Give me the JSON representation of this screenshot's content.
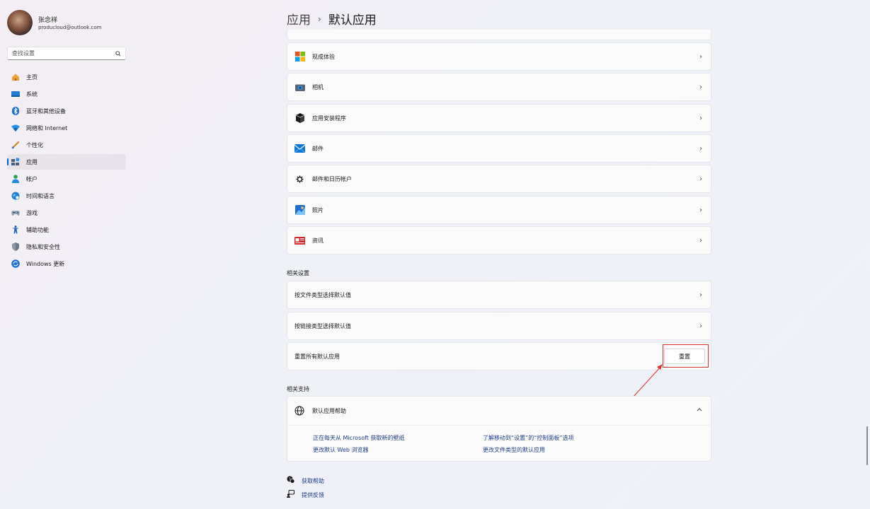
{
  "profile": {
    "name": "张念祥",
    "email": "producloud@outlook.com"
  },
  "search": {
    "placeholder": "查找设置"
  },
  "nav": [
    {
      "label": "主页",
      "icon": "home-icon"
    },
    {
      "label": "系统",
      "icon": "system-icon"
    },
    {
      "label": "蓝牙和其他设备",
      "icon": "bluetooth-icon"
    },
    {
      "label": "网络和 Internet",
      "icon": "wifi-icon"
    },
    {
      "label": "个性化",
      "icon": "brush-icon"
    },
    {
      "label": "应用",
      "icon": "apps-icon",
      "active": true
    },
    {
      "label": "帐户",
      "icon": "account-icon"
    },
    {
      "label": "时间和语言",
      "icon": "globe-clock-icon"
    },
    {
      "label": "游戏",
      "icon": "gamepad-icon"
    },
    {
      "label": "辅助功能",
      "icon": "accessibility-icon"
    },
    {
      "label": "隐私和安全性",
      "icon": "shield-icon"
    },
    {
      "label": "Windows 更新",
      "icon": "update-icon"
    }
  ],
  "breadcrumb": {
    "parent": "应用",
    "separator": "›",
    "current": "默认应用"
  },
  "apps": [
    {
      "label": "现成体验",
      "icon": "windows-logo-icon"
    },
    {
      "label": "相机",
      "icon": "camera-icon"
    },
    {
      "label": "应用安装程序",
      "icon": "box-icon"
    },
    {
      "label": "邮件",
      "icon": "mail-icon"
    },
    {
      "label": "邮件和日历帐户",
      "icon": "gear-icon"
    },
    {
      "label": "照片",
      "icon": "photos-icon"
    },
    {
      "label": "资讯",
      "icon": "news-icon"
    }
  ],
  "related_settings": {
    "heading": "相关设置",
    "by_file_type": "按文件类型选择默认值",
    "by_link_type": "按链接类型选择默认值",
    "reset_label": "重置所有默认应用",
    "reset_button": "重置"
  },
  "related_support": {
    "heading": "相关支持",
    "help_title": "默认应用帮助",
    "links": [
      "正在每天从 Microsoft 获取新的壁纸",
      "了解移动到“设置”的“控制面板”选项",
      "更改默认 Web 浏览器",
      "更改文件类型的默认应用"
    ]
  },
  "footer": {
    "get_help": "获取帮助",
    "feedback": "提供反馈"
  },
  "colors": {
    "accent": "#0067c0",
    "highlight": "#e03030",
    "link": "#1f3c88"
  }
}
